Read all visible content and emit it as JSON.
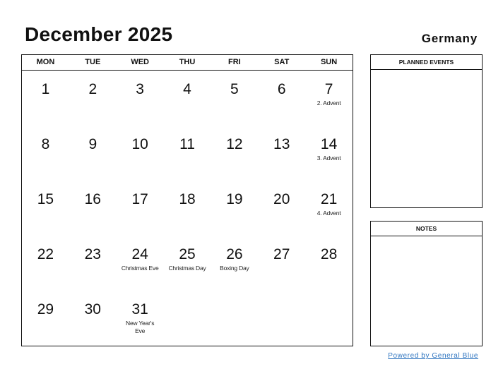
{
  "header": {
    "title": "December 2025",
    "country": "Germany"
  },
  "calendar": {
    "weekdays": [
      "MON",
      "TUE",
      "WED",
      "THU",
      "FRI",
      "SAT",
      "SUN"
    ],
    "weeks": [
      [
        {
          "day": "1",
          "holiday": ""
        },
        {
          "day": "2",
          "holiday": ""
        },
        {
          "day": "3",
          "holiday": ""
        },
        {
          "day": "4",
          "holiday": ""
        },
        {
          "day": "5",
          "holiday": ""
        },
        {
          "day": "6",
          "holiday": ""
        },
        {
          "day": "7",
          "holiday": "2. Advent"
        }
      ],
      [
        {
          "day": "8",
          "holiday": ""
        },
        {
          "day": "9",
          "holiday": ""
        },
        {
          "day": "10",
          "holiday": ""
        },
        {
          "day": "11",
          "holiday": ""
        },
        {
          "day": "12",
          "holiday": ""
        },
        {
          "day": "13",
          "holiday": ""
        },
        {
          "day": "14",
          "holiday": "3. Advent"
        }
      ],
      [
        {
          "day": "15",
          "holiday": ""
        },
        {
          "day": "16",
          "holiday": ""
        },
        {
          "day": "17",
          "holiday": ""
        },
        {
          "day": "18",
          "holiday": ""
        },
        {
          "day": "19",
          "holiday": ""
        },
        {
          "day": "20",
          "holiday": ""
        },
        {
          "day": "21",
          "holiday": "4. Advent"
        }
      ],
      [
        {
          "day": "22",
          "holiday": ""
        },
        {
          "day": "23",
          "holiday": ""
        },
        {
          "day": "24",
          "holiday": "Christmas Eve"
        },
        {
          "day": "25",
          "holiday": "Christmas Day"
        },
        {
          "day": "26",
          "holiday": "Boxing Day"
        },
        {
          "day": "27",
          "holiday": ""
        },
        {
          "day": "28",
          "holiday": ""
        }
      ],
      [
        {
          "day": "29",
          "holiday": ""
        },
        {
          "day": "30",
          "holiday": ""
        },
        {
          "day": "31",
          "holiday": "New Year's Eve"
        },
        {
          "day": "",
          "holiday": ""
        },
        {
          "day": "",
          "holiday": ""
        },
        {
          "day": "",
          "holiday": ""
        },
        {
          "day": "",
          "holiday": ""
        }
      ]
    ]
  },
  "panels": {
    "planned_events": "PLANNED EVENTS",
    "notes": "NOTES"
  },
  "footer": {
    "link_text": "Powered by General Blue",
    "link_color": "#2f75c0"
  }
}
